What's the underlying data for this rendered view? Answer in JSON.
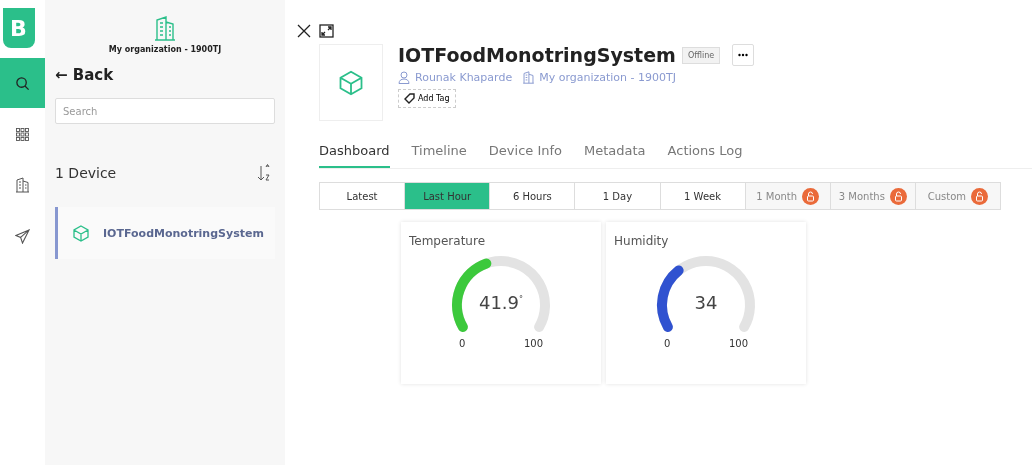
{
  "rail": {
    "logo": "B",
    "items": [
      {
        "kind": "search",
        "selected": true
      },
      {
        "kind": "grid",
        "selected": false
      },
      {
        "kind": "building",
        "selected": false
      },
      {
        "kind": "send",
        "selected": false
      }
    ]
  },
  "sidebar": {
    "organization": "My organization - 1900TJ",
    "back": "← Back",
    "search": {
      "placeholder": "Search"
    },
    "count": "1 Device",
    "devices": [
      {
        "name": "IOTFoodMonotringSystem",
        "selected": true
      }
    ]
  },
  "device": {
    "name": "IOTFoodMonotringSystem",
    "status": "Offline",
    "owner": "Rounak Khaparde",
    "organization": "My organization - 1900TJ",
    "add_tag": "Add Tag"
  },
  "tabs": [
    {
      "label": "Dashboard",
      "selected": true
    },
    {
      "label": "Timeline",
      "selected": false
    },
    {
      "label": "Device Info",
      "selected": false
    },
    {
      "label": "Metadata",
      "selected": false
    },
    {
      "label": "Actions Log",
      "selected": false
    }
  ],
  "ranges": [
    {
      "label": "Latest",
      "selected": false,
      "locked": false
    },
    {
      "label": "Last Hour",
      "selected": true,
      "locked": false
    },
    {
      "label": "6 Hours",
      "selected": false,
      "locked": false
    },
    {
      "label": "1 Day",
      "selected": false,
      "locked": false
    },
    {
      "label": "1 Week",
      "selected": false,
      "locked": false
    },
    {
      "label": "1 Month",
      "selected": false,
      "locked": true
    },
    {
      "label": "3 Months",
      "selected": false,
      "locked": true
    },
    {
      "label": "Custom",
      "selected": false,
      "locked": true
    }
  ],
  "widgets": [
    {
      "title": "Temperature",
      "value": "41.9",
      "unit": "°",
      "color": "#3cc93c",
      "min": "0",
      "max": "100"
    },
    {
      "title": "Humidity",
      "value": "34",
      "color": "#3052d0",
      "min": "0",
      "max": "100"
    }
  ]
}
